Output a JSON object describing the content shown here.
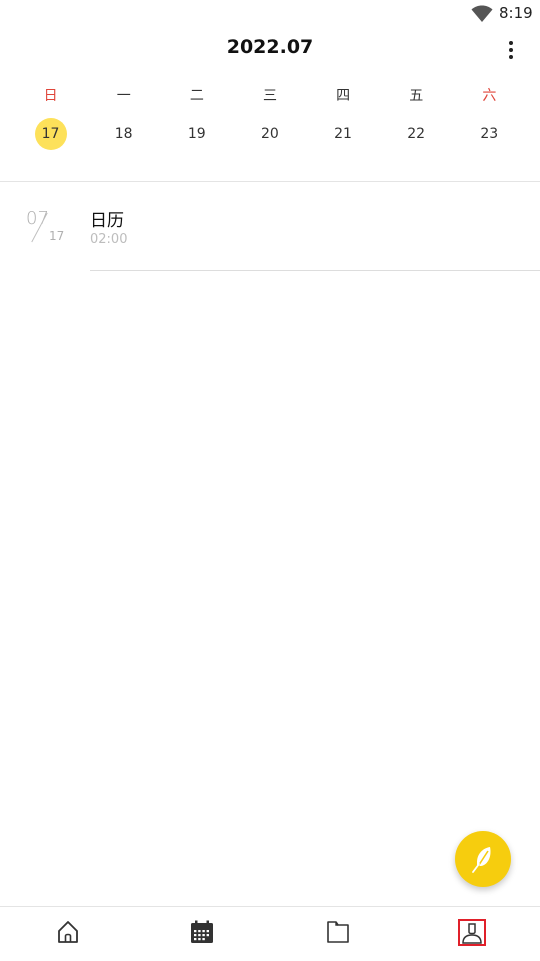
{
  "status_bar": {
    "time": "8:19",
    "wifi_icon": "wifi-icon"
  },
  "header": {
    "title": "2022.07",
    "more_icon": "more-vertical-icon"
  },
  "calendar": {
    "weekdays": [
      "日",
      "一",
      "二",
      "三",
      "四",
      "五",
      "六"
    ],
    "dates": [
      "17",
      "18",
      "19",
      "20",
      "21",
      "22",
      "23"
    ],
    "selected_date": "17",
    "weekend_color": "#e0453a",
    "selected_color": "#fde15a"
  },
  "events": [
    {
      "month": "07",
      "day": "17",
      "title": "日历",
      "time": "02:00"
    }
  ],
  "fab": {
    "icon": "feather-icon",
    "color": "#f6cd0e"
  },
  "bottom_nav": {
    "items": [
      {
        "icon": "home-icon"
      },
      {
        "icon": "calendar-icon"
      },
      {
        "icon": "folder-icon"
      },
      {
        "icon": "profile-icon",
        "highlighted": true
      }
    ]
  }
}
